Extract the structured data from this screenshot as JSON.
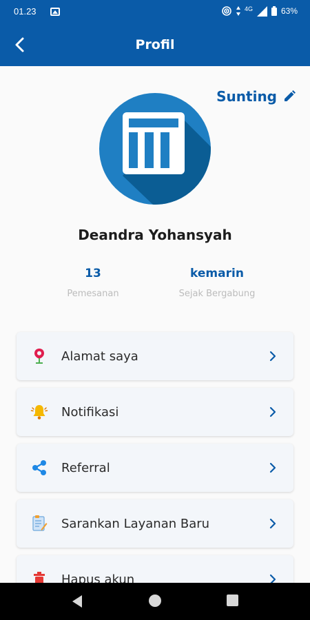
{
  "status_bar": {
    "time": "01.23",
    "network": "4G",
    "battery": "63%"
  },
  "app_bar": {
    "title": "Profil"
  },
  "profile": {
    "edit_label": "Sunting",
    "name": "Deandra Yohansyah",
    "stats": [
      {
        "value": "13",
        "label": "Pemesanan"
      },
      {
        "value": "kemarin",
        "label": "Sejak Bergabung"
      }
    ]
  },
  "menu": [
    {
      "label": "Alamat saya",
      "icon": "location-pin-icon"
    },
    {
      "label": "Notifikasi",
      "icon": "bell-icon"
    },
    {
      "label": "Referral",
      "icon": "share-icon"
    },
    {
      "label": "Sarankan Layanan Baru",
      "icon": "suggest-document-icon"
    },
    {
      "label": "Hapus akun",
      "icon": "trash-icon"
    }
  ],
  "colors": {
    "primary": "#0a5ba8",
    "avatar_bg": "#1f7fc3",
    "muted_text": "#bcbcbc"
  }
}
